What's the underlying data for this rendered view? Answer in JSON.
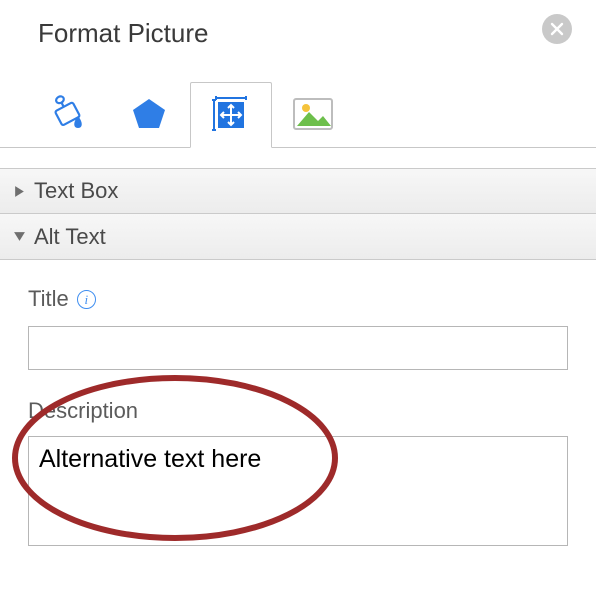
{
  "header": {
    "title": "Format Picture"
  },
  "tabs": {
    "fill": "fill-line-tab",
    "effects": "effects-tab",
    "size": "size-properties-tab",
    "picture": "picture-tab"
  },
  "sections": {
    "textbox_label": "Text Box",
    "alttext_label": "Alt Text"
  },
  "alttext": {
    "title_label": "Title",
    "title_value": "",
    "description_label": "Description",
    "description_value": "Alternative text here"
  }
}
